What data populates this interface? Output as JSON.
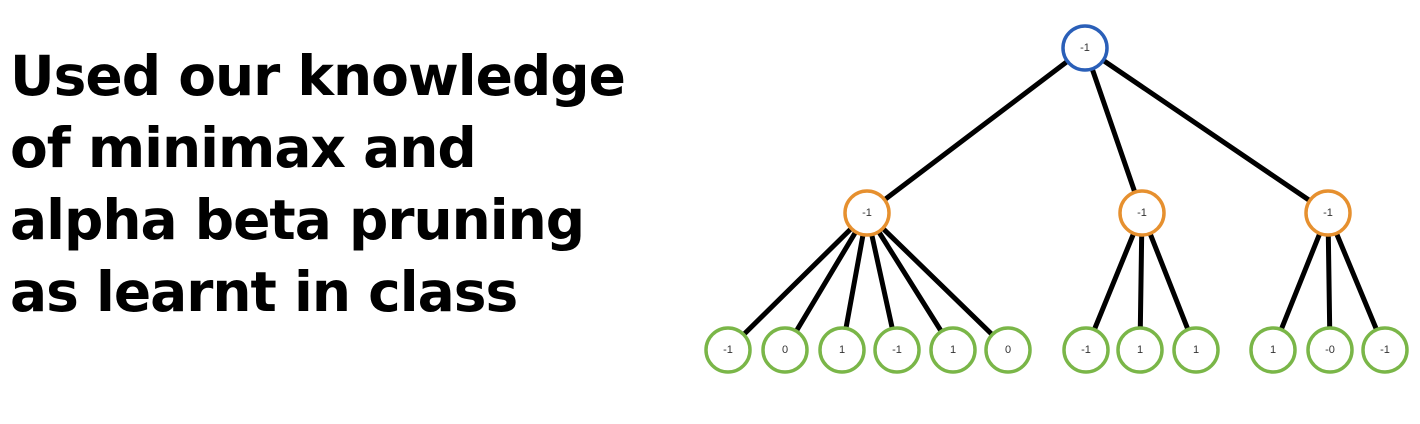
{
  "headline": {
    "lines": [
      "Used our knowledge",
      "of minimax and",
      "alpha beta pruning",
      "as learnt in class"
    ]
  },
  "tree": {
    "colors": {
      "root": "#2a5fb8",
      "min": "#e6902f",
      "leaf": "#7ab648",
      "edge": "#000000"
    },
    "root": {
      "value": "-1",
      "children": [
        {
          "value": "-1",
          "children": [
            "-1",
            "0",
            "1",
            "-1",
            "1",
            "0"
          ]
        },
        {
          "value": "-1",
          "children": [
            "-1",
            "1",
            "1"
          ]
        },
        {
          "value": "-1",
          "children": [
            "1",
            "-0",
            "-1"
          ]
        }
      ]
    }
  }
}
